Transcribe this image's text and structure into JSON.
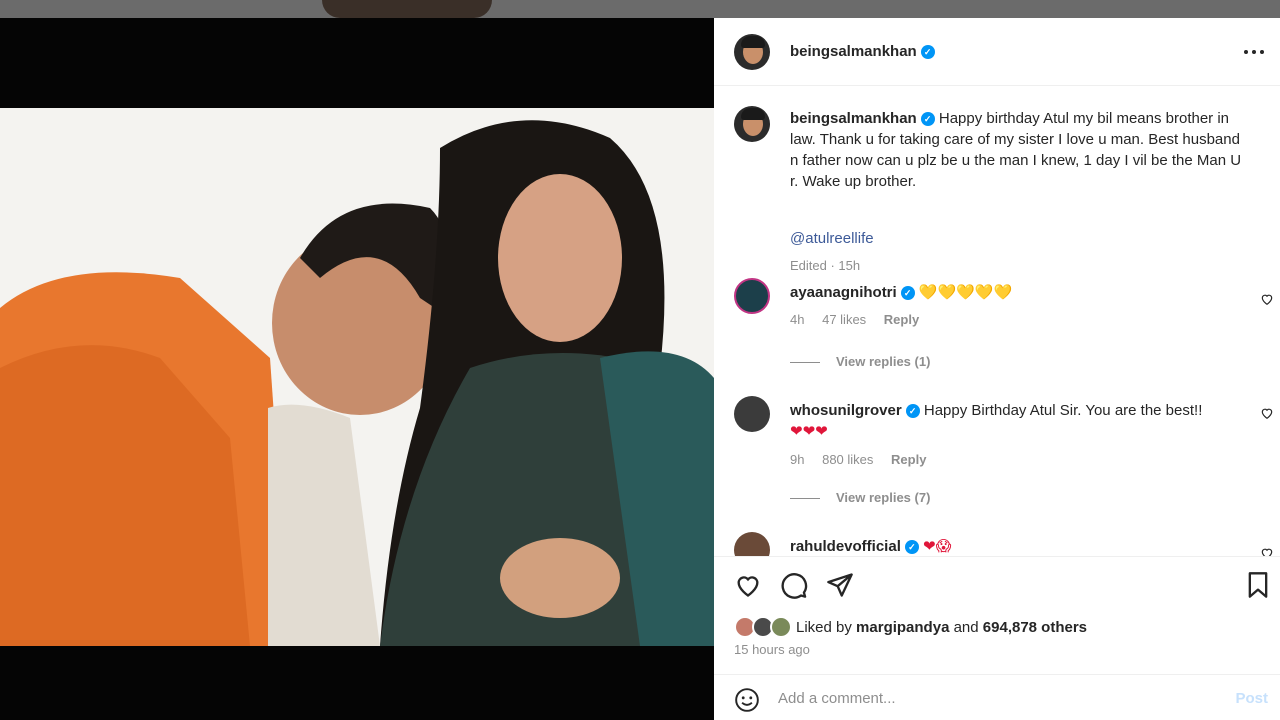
{
  "post": {
    "username": "beingsalmankhan",
    "caption": "Happy birthday Atul my bil means brother in law. Thank u for taking care of my sister I love u man. Best husband n father now can u plz be u the man I knew, 1 day I vil be the Man U r. Wake up brother.",
    "mention": "@atulreellife",
    "edited_meta": "Edited · 15h"
  },
  "comments": [
    {
      "username": "ayaanagnihotri",
      "text": "",
      "emojis": "💛💛💛💛💛",
      "time": "4h",
      "likes": "47 likes",
      "reply": "Reply",
      "view_replies": "View replies (1)"
    },
    {
      "username": "whosunilgrover",
      "text": "Happy Birthday Atul Sir. You are the best!!",
      "emojis": "❤❤❤",
      "time": "9h",
      "likes": "880 likes",
      "reply": "Reply",
      "view_replies": "View replies (7)"
    },
    {
      "username": "rahuldevofficial",
      "text": "",
      "emojis": "❤😱"
    }
  ],
  "likes": {
    "prefix": "Liked by",
    "user": "margipandya",
    "and": "and",
    "count": "694,878 others"
  },
  "time_ago": "15 hours ago",
  "add_comment": {
    "placeholder": "Add a comment...",
    "post_label": "Post"
  },
  "colors": {
    "verified": "#0095f6",
    "link": "#3d5a98",
    "muted": "#8e8e8e"
  }
}
